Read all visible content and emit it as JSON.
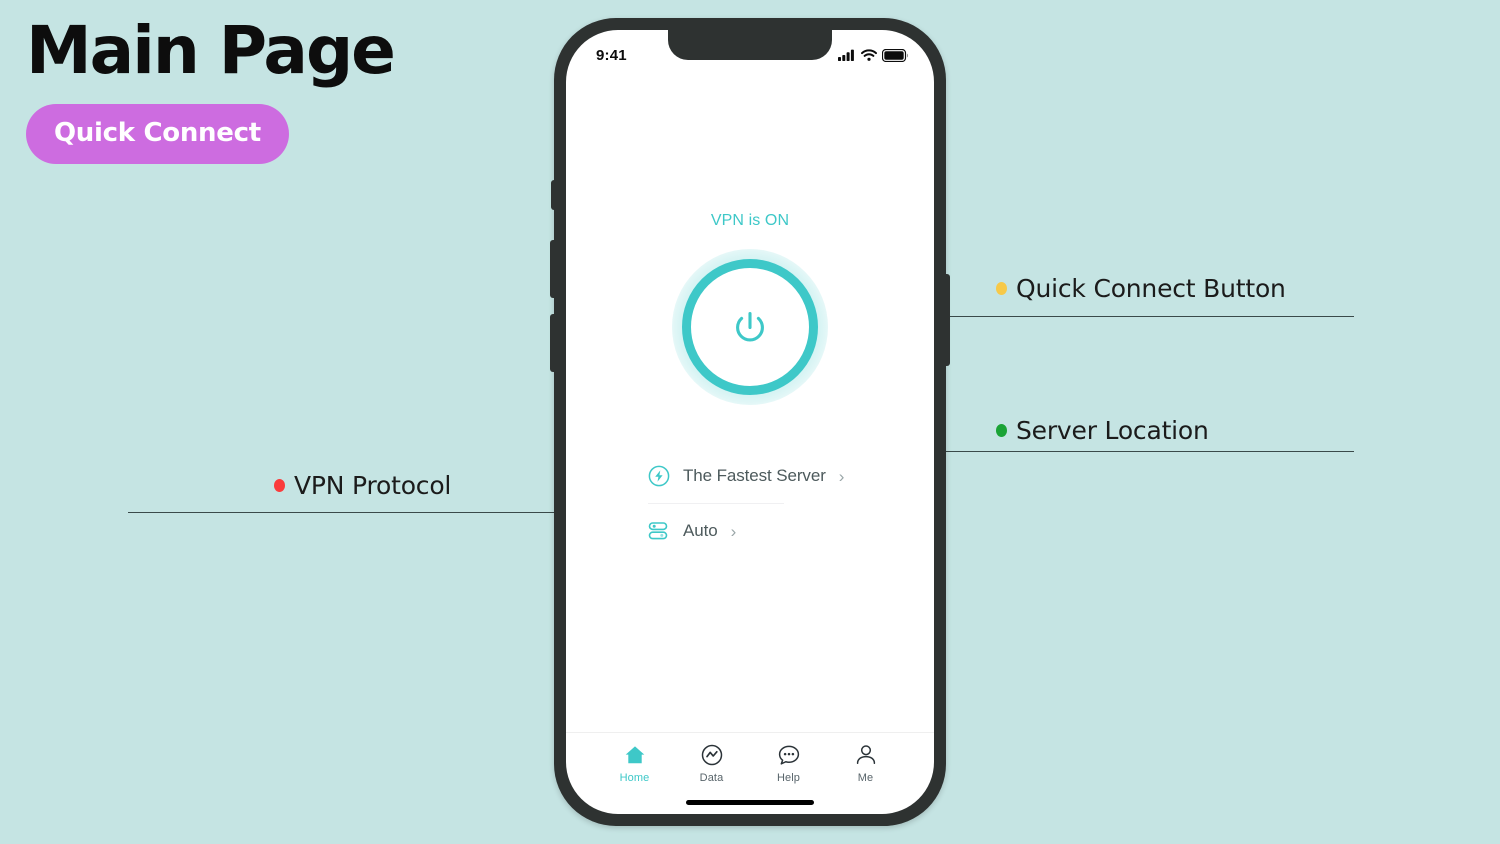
{
  "caption": {
    "title": "Main Page",
    "badge_label": "Quick Connect",
    "badge_color": "#cd6ce0"
  },
  "background_color": "#c5e4e3",
  "accent_color": "#3ec8c8",
  "annotations": [
    {
      "id": "quick-connect-button",
      "label": "Quick Connect Button",
      "dot_color": "#f7c948",
      "side": "right"
    },
    {
      "id": "server-location",
      "label": "Server Location",
      "dot_color": "#1aa336",
      "side": "right"
    },
    {
      "id": "vpn-protocol",
      "label": "VPN Protocol",
      "dot_color": "#fa3c3c",
      "side": "left"
    }
  ],
  "phone": {
    "status_bar": {
      "time": "9:41",
      "icons": [
        "cellular-signal-icon",
        "wifi-icon",
        "battery-icon"
      ]
    },
    "vpn": {
      "status_text": "VPN is ON",
      "power_button_icon": "power-icon"
    },
    "options": [
      {
        "icon": "lightning-bolt-circle-icon",
        "label": "The Fastest Server",
        "chevron": "›"
      },
      {
        "icon": "server-stack-icon",
        "label": "Auto",
        "chevron": "›"
      }
    ],
    "tabs": [
      {
        "icon": "home-icon",
        "label": "Home",
        "active": true
      },
      {
        "icon": "data-icon",
        "label": "Data",
        "active": false
      },
      {
        "icon": "help-icon",
        "label": "Help",
        "active": false
      },
      {
        "icon": "person-icon",
        "label": "Me",
        "active": false
      }
    ]
  }
}
